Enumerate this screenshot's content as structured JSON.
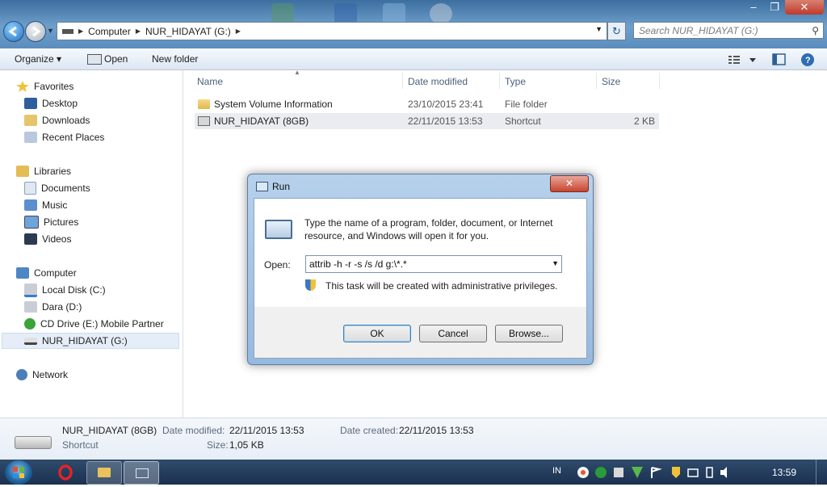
{
  "window": {
    "controls": {
      "minimize": "–",
      "maximize": "❐",
      "close": "✕"
    }
  },
  "address": {
    "segments": [
      "Computer",
      "NUR_HIDAYAT (G:)"
    ],
    "search_placeholder": "Search NUR_HIDAYAT (G:)"
  },
  "toolbar": {
    "organize": "Organize ▾",
    "open": "Open",
    "new_folder": "New folder"
  },
  "nav": {
    "favorites": "Favorites",
    "desktop": "Desktop",
    "downloads": "Downloads",
    "recent_places": "Recent Places",
    "libraries": "Libraries",
    "documents": "Documents",
    "music": "Music",
    "pictures": "Pictures",
    "videos": "Videos",
    "computer": "Computer",
    "local_disk": "Local Disk (C:)",
    "dara": "Dara (D:)",
    "cd_drive": "CD Drive (E:) Mobile Partner",
    "nur_hidayat": "NUR_HIDAYAT (G:)",
    "network": "Network"
  },
  "columns": {
    "name": "Name",
    "date": "Date modified",
    "type": "Type",
    "size": "Size"
  },
  "files": [
    {
      "name": "System Volume Information",
      "date": "23/10/2015 23:41",
      "type": "File folder",
      "size": ""
    },
    {
      "name": "NUR_HIDAYAT (8GB)",
      "date": "22/11/2015 13:53",
      "type": "Shortcut",
      "size": "2 KB"
    }
  ],
  "details": {
    "name": "NUR_HIDAYAT (8GB)",
    "type": "Shortcut",
    "modified_label": "Date modified:",
    "modified_value": "22/11/2015 13:53",
    "size_label": "Size:",
    "size_value": "1,05 KB",
    "created_label": "Date created:",
    "created_value": "22/11/2015 13:53"
  },
  "run": {
    "title": "Run",
    "close": "✕",
    "description": "Type the name of a program, folder, document, or Internet resource, and Windows will open it for you.",
    "open_label": "Open:",
    "command": "attrib -h -r -s /s /d g:\\*.*",
    "admin_note": "This task will be created with administrative privileges.",
    "ok": "OK",
    "cancel": "Cancel",
    "browse": "Browse..."
  },
  "taskbar": {
    "language": "IN",
    "clock": "13:59"
  }
}
